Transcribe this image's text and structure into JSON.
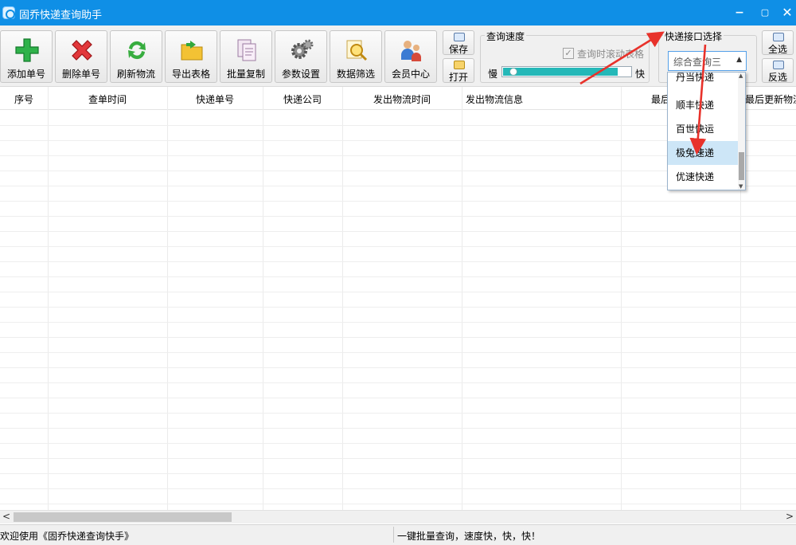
{
  "window": {
    "title": "固乔快递查询助手",
    "controls": {
      "minimize": "−",
      "maximize": "▢",
      "close": "✕"
    }
  },
  "toolbar": {
    "buttons": [
      {
        "label": "添加单号",
        "icon": "add-icon"
      },
      {
        "label": "删除单号",
        "icon": "delete-icon"
      },
      {
        "label": "刷新物流",
        "icon": "refresh-icon"
      },
      {
        "label": "导出表格",
        "icon": "export-folder-icon"
      },
      {
        "label": "批量复制",
        "icon": "copy-icon"
      },
      {
        "label": "参数设置",
        "icon": "gear-icon"
      },
      {
        "label": "数据筛选",
        "icon": "search-filter-icon"
      },
      {
        "label": "会员中心",
        "icon": "members-icon"
      }
    ],
    "save_label": "保存",
    "open_label": "打开",
    "select_all_label": "全选",
    "invert_label": "反选"
  },
  "speed": {
    "legend": "查询速度",
    "scroll_checkbox_label": "查询时滚动表格",
    "checked": true,
    "slow_label": "慢",
    "fast_label": "快",
    "level": 0.9
  },
  "api": {
    "legend": "快递接口选择",
    "selected": "综合查询三",
    "options": [
      "丹当快递",
      "顺丰快递",
      "百世快运",
      "极兔速递",
      "优速快递"
    ],
    "highlighted": "极兔速递"
  },
  "table": {
    "columns": [
      "序号",
      "查单时间",
      "快递单号",
      "快递公司",
      "发出物流时间",
      "发出物流信息",
      "最后",
      "最后更新物流"
    ],
    "rows": []
  },
  "status": {
    "left": "欢迎使用《固乔快递查询快手》",
    "right": "一键批量查询，速度快，快，快！"
  },
  "colors": {
    "titlebar": "#0f8fe6",
    "slider_fill": "#24b8b8",
    "annotation_arrow": "#e8322b",
    "dropdown_highlight": "#cde6f7"
  }
}
